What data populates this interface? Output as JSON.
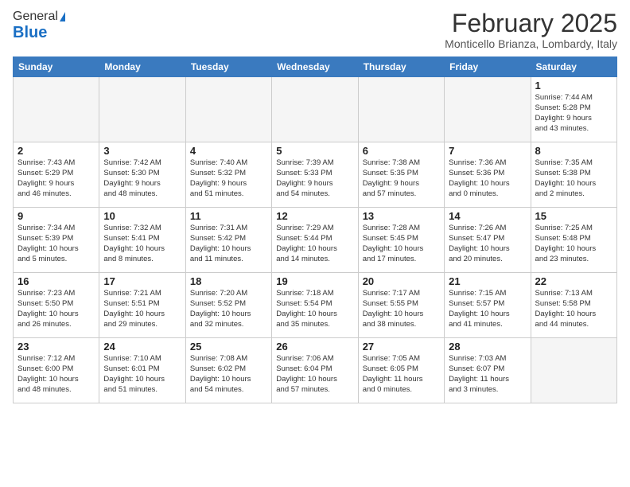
{
  "logo": {
    "general": "General",
    "blue": "Blue"
  },
  "header": {
    "month": "February 2025",
    "location": "Monticello Brianza, Lombardy, Italy"
  },
  "weekdays": [
    "Sunday",
    "Monday",
    "Tuesday",
    "Wednesday",
    "Thursday",
    "Friday",
    "Saturday"
  ],
  "weeks": [
    [
      {
        "day": "",
        "info": ""
      },
      {
        "day": "",
        "info": ""
      },
      {
        "day": "",
        "info": ""
      },
      {
        "day": "",
        "info": ""
      },
      {
        "day": "",
        "info": ""
      },
      {
        "day": "",
        "info": ""
      },
      {
        "day": "1",
        "info": "Sunrise: 7:44 AM\nSunset: 5:28 PM\nDaylight: 9 hours\nand 43 minutes."
      }
    ],
    [
      {
        "day": "2",
        "info": "Sunrise: 7:43 AM\nSunset: 5:29 PM\nDaylight: 9 hours\nand 46 minutes."
      },
      {
        "day": "3",
        "info": "Sunrise: 7:42 AM\nSunset: 5:30 PM\nDaylight: 9 hours\nand 48 minutes."
      },
      {
        "day": "4",
        "info": "Sunrise: 7:40 AM\nSunset: 5:32 PM\nDaylight: 9 hours\nand 51 minutes."
      },
      {
        "day": "5",
        "info": "Sunrise: 7:39 AM\nSunset: 5:33 PM\nDaylight: 9 hours\nand 54 minutes."
      },
      {
        "day": "6",
        "info": "Sunrise: 7:38 AM\nSunset: 5:35 PM\nDaylight: 9 hours\nand 57 minutes."
      },
      {
        "day": "7",
        "info": "Sunrise: 7:36 AM\nSunset: 5:36 PM\nDaylight: 10 hours\nand 0 minutes."
      },
      {
        "day": "8",
        "info": "Sunrise: 7:35 AM\nSunset: 5:38 PM\nDaylight: 10 hours\nand 2 minutes."
      }
    ],
    [
      {
        "day": "9",
        "info": "Sunrise: 7:34 AM\nSunset: 5:39 PM\nDaylight: 10 hours\nand 5 minutes."
      },
      {
        "day": "10",
        "info": "Sunrise: 7:32 AM\nSunset: 5:41 PM\nDaylight: 10 hours\nand 8 minutes."
      },
      {
        "day": "11",
        "info": "Sunrise: 7:31 AM\nSunset: 5:42 PM\nDaylight: 10 hours\nand 11 minutes."
      },
      {
        "day": "12",
        "info": "Sunrise: 7:29 AM\nSunset: 5:44 PM\nDaylight: 10 hours\nand 14 minutes."
      },
      {
        "day": "13",
        "info": "Sunrise: 7:28 AM\nSunset: 5:45 PM\nDaylight: 10 hours\nand 17 minutes."
      },
      {
        "day": "14",
        "info": "Sunrise: 7:26 AM\nSunset: 5:47 PM\nDaylight: 10 hours\nand 20 minutes."
      },
      {
        "day": "15",
        "info": "Sunrise: 7:25 AM\nSunset: 5:48 PM\nDaylight: 10 hours\nand 23 minutes."
      }
    ],
    [
      {
        "day": "16",
        "info": "Sunrise: 7:23 AM\nSunset: 5:50 PM\nDaylight: 10 hours\nand 26 minutes."
      },
      {
        "day": "17",
        "info": "Sunrise: 7:21 AM\nSunset: 5:51 PM\nDaylight: 10 hours\nand 29 minutes."
      },
      {
        "day": "18",
        "info": "Sunrise: 7:20 AM\nSunset: 5:52 PM\nDaylight: 10 hours\nand 32 minutes."
      },
      {
        "day": "19",
        "info": "Sunrise: 7:18 AM\nSunset: 5:54 PM\nDaylight: 10 hours\nand 35 minutes."
      },
      {
        "day": "20",
        "info": "Sunrise: 7:17 AM\nSunset: 5:55 PM\nDaylight: 10 hours\nand 38 minutes."
      },
      {
        "day": "21",
        "info": "Sunrise: 7:15 AM\nSunset: 5:57 PM\nDaylight: 10 hours\nand 41 minutes."
      },
      {
        "day": "22",
        "info": "Sunrise: 7:13 AM\nSunset: 5:58 PM\nDaylight: 10 hours\nand 44 minutes."
      }
    ],
    [
      {
        "day": "23",
        "info": "Sunrise: 7:12 AM\nSunset: 6:00 PM\nDaylight: 10 hours\nand 48 minutes."
      },
      {
        "day": "24",
        "info": "Sunrise: 7:10 AM\nSunset: 6:01 PM\nDaylight: 10 hours\nand 51 minutes."
      },
      {
        "day": "25",
        "info": "Sunrise: 7:08 AM\nSunset: 6:02 PM\nDaylight: 10 hours\nand 54 minutes."
      },
      {
        "day": "26",
        "info": "Sunrise: 7:06 AM\nSunset: 6:04 PM\nDaylight: 10 hours\nand 57 minutes."
      },
      {
        "day": "27",
        "info": "Sunrise: 7:05 AM\nSunset: 6:05 PM\nDaylight: 11 hours\nand 0 minutes."
      },
      {
        "day": "28",
        "info": "Sunrise: 7:03 AM\nSunset: 6:07 PM\nDaylight: 11 hours\nand 3 minutes."
      },
      {
        "day": "",
        "info": ""
      }
    ]
  ]
}
